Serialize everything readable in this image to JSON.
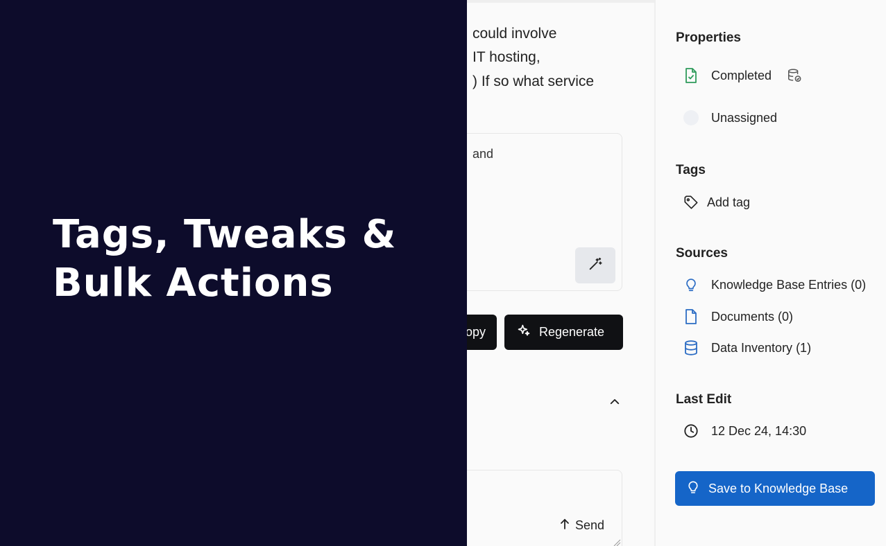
{
  "overlay": {
    "title_line1": "Tags, Tweaks &",
    "title_line2": "Bulk Actions"
  },
  "question": {
    "line1": "could involve",
    "line2": "IT hosting,",
    "line3": ") If so what service"
  },
  "answer": {
    "text": "and"
  },
  "actions": {
    "copy_label": "opy",
    "regenerate_label": "Regenerate"
  },
  "reply": {
    "send_label": "Send"
  },
  "sidebar": {
    "properties_title": "Properties",
    "status": "Completed",
    "assignee": "Unassigned",
    "tags_title": "Tags",
    "add_tag_label": "Add tag",
    "sources_title": "Sources",
    "sources": [
      {
        "label": "Knowledge Base Entries (0)",
        "icon": "lightbulb-icon"
      },
      {
        "label": "Documents (0)",
        "icon": "document-icon"
      },
      {
        "label": "Data Inventory (1)",
        "icon": "database-icon"
      }
    ],
    "last_edit_title": "Last Edit",
    "last_edit_value": "12 Dec 24, 14:30",
    "save_button_label": "Save to Knowledge Base"
  },
  "colors": {
    "overlay_bg": "#0d0c2b",
    "status_green": "#2e9b5b",
    "source_blue": "#2b6cc4",
    "save_button_blue": "#1565c8"
  }
}
